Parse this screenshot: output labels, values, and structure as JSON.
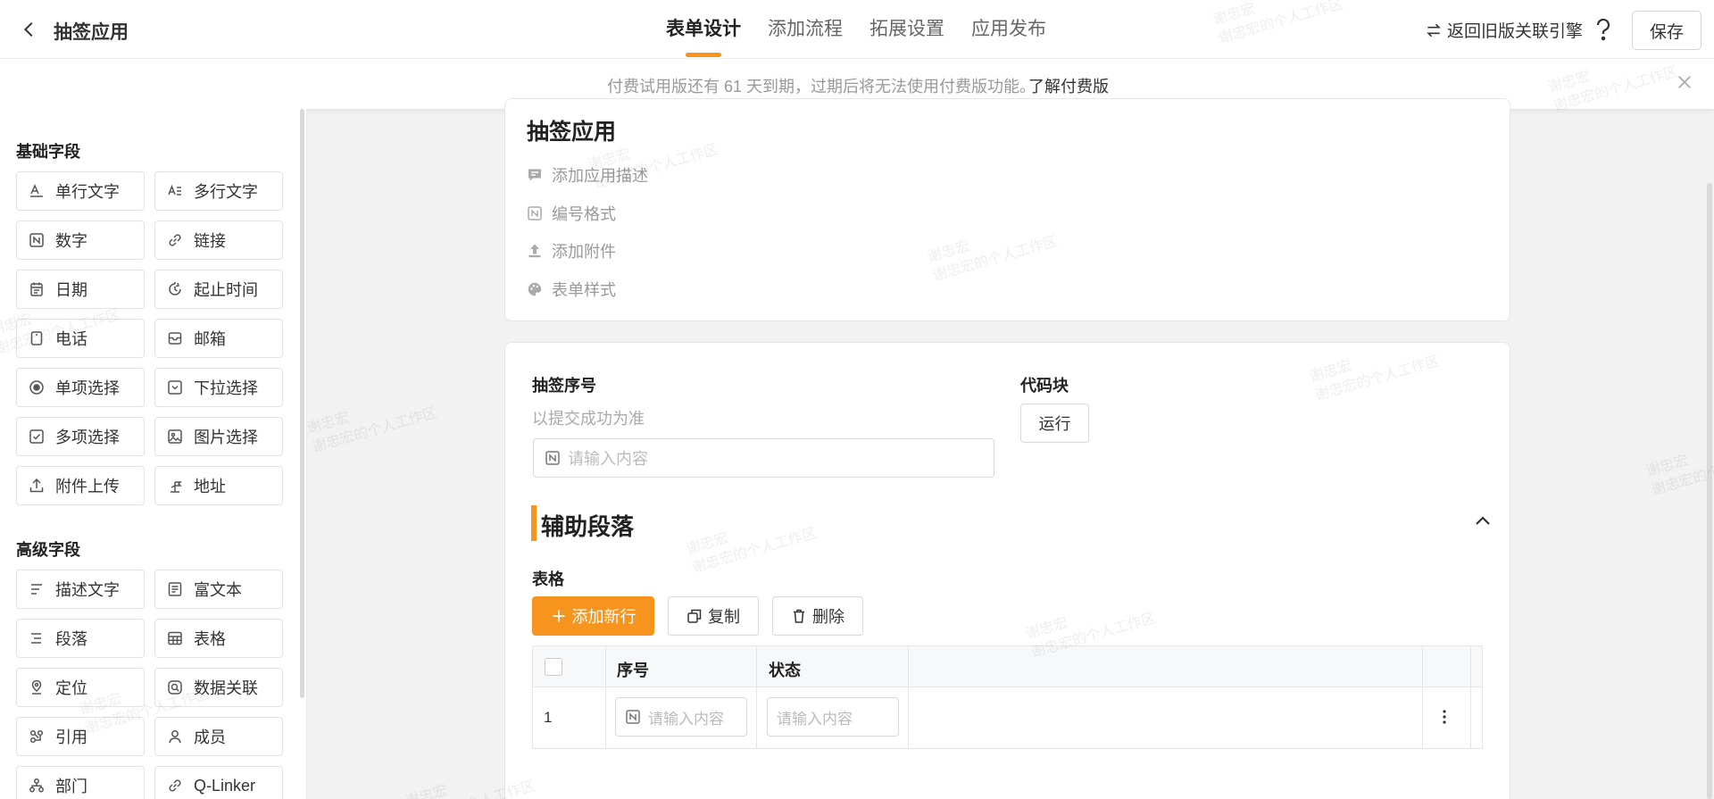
{
  "header": {
    "app_title": "抽签应用",
    "tabs": [
      {
        "label": "表单设计",
        "active": true
      },
      {
        "label": "添加流程",
        "active": false
      },
      {
        "label": "拓展设置",
        "active": false
      },
      {
        "label": "应用发布",
        "active": false
      }
    ],
    "old_ref_label": "返回旧版关联引擎",
    "help_label": "?",
    "save_label": "保存"
  },
  "notice": {
    "text": "付费试用版还有 61 天到期，过期后将无法使用付费版功能。",
    "link": "了解付费版"
  },
  "sidebar": {
    "basic_title": "基础字段",
    "basic_fields": [
      {
        "label": "单行文字",
        "icon": "single-line-text-icon"
      },
      {
        "label": "多行文字",
        "icon": "multi-line-text-icon"
      },
      {
        "label": "数字",
        "icon": "number-icon"
      },
      {
        "label": "链接",
        "icon": "link-icon"
      },
      {
        "label": "日期",
        "icon": "calendar-icon"
      },
      {
        "label": "起止时间",
        "icon": "time-range-icon"
      },
      {
        "label": "电话",
        "icon": "phone-icon"
      },
      {
        "label": "邮箱",
        "icon": "mail-icon"
      },
      {
        "label": "单项选择",
        "icon": "radio-icon"
      },
      {
        "label": "下拉选择",
        "icon": "dropdown-icon"
      },
      {
        "label": "多项选择",
        "icon": "checkbox-icon"
      },
      {
        "label": "图片选择",
        "icon": "image-icon"
      },
      {
        "label": "附件上传",
        "icon": "upload-icon"
      },
      {
        "label": "地址",
        "icon": "address-icon"
      }
    ],
    "advanced_title": "高级字段",
    "advanced_fields": [
      {
        "label": "描述文字",
        "icon": "description-icon"
      },
      {
        "label": "富文本",
        "icon": "rich-text-icon"
      },
      {
        "label": "段落",
        "icon": "paragraph-icon"
      },
      {
        "label": "表格",
        "icon": "table-icon"
      },
      {
        "label": "定位",
        "icon": "location-icon"
      },
      {
        "label": "数据关联",
        "icon": "data-link-icon"
      },
      {
        "label": "引用",
        "icon": "reference-icon"
      },
      {
        "label": "成员",
        "icon": "member-icon"
      },
      {
        "label": "部门",
        "icon": "department-icon"
      },
      {
        "label": "Q-Linker",
        "icon": "q-linker-icon"
      }
    ]
  },
  "form": {
    "title": "抽签应用",
    "options": [
      {
        "label": "添加应用描述",
        "icon": "comment-icon"
      },
      {
        "label": "编号格式",
        "icon": "number-format-icon"
      },
      {
        "label": "添加附件",
        "icon": "attachment-upload-icon"
      },
      {
        "label": "表单样式",
        "icon": "palette-icon"
      }
    ],
    "serial_field": {
      "label": "抽签序号",
      "hint": "以提交成功为准",
      "placeholder": "请输入内容"
    },
    "code_block": {
      "label": "代码块",
      "run_label": "运行"
    },
    "paragraph_title": "辅助段落",
    "table": {
      "label": "表格",
      "add_row_label": "添加新行",
      "copy_label": "复制",
      "delete_label": "删除",
      "columns": [
        "序号",
        "状态"
      ],
      "rows": [
        {
          "index": "1",
          "seq_placeholder": "请输入内容",
          "status_placeholder": "请输入内容"
        }
      ]
    }
  },
  "watermark": {
    "line1": "谢忠宏",
    "line2": "谢忠宏的个人工作区"
  },
  "colors": {
    "accent": "#f7941d",
    "text": "#333333",
    "muted": "#999999"
  }
}
